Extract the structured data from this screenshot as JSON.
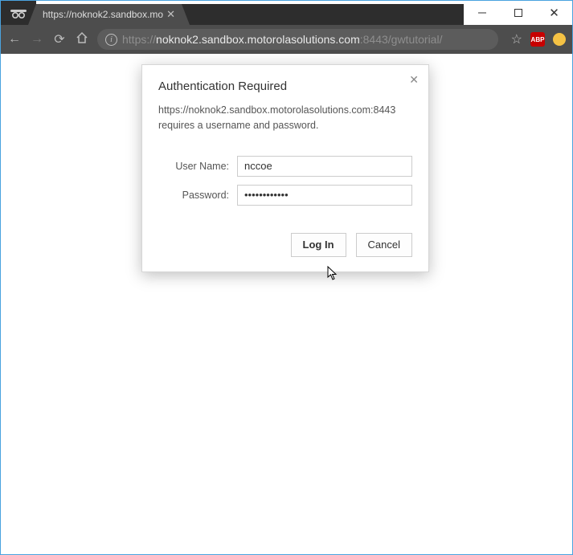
{
  "window": {
    "tab_title": "https://noknok2.sandbox.mo",
    "controls": {
      "min": "min",
      "max": "max",
      "close": "close"
    }
  },
  "toolbar": {
    "url_scheme": "https://",
    "url_host": "noknok2.sandbox.motorolasolutions.com",
    "url_port_path": ":8443/gwtutorial/",
    "abp_label": "ABP"
  },
  "dialog": {
    "title": "Authentication Required",
    "message": "https://noknok2.sandbox.motorolasolutions.com:8443 requires a username and password.",
    "username_label": "User Name:",
    "username_value": "nccoe",
    "password_label": "Password:",
    "password_value": "passwordpass",
    "login_label": "Log In",
    "cancel_label": "Cancel"
  }
}
